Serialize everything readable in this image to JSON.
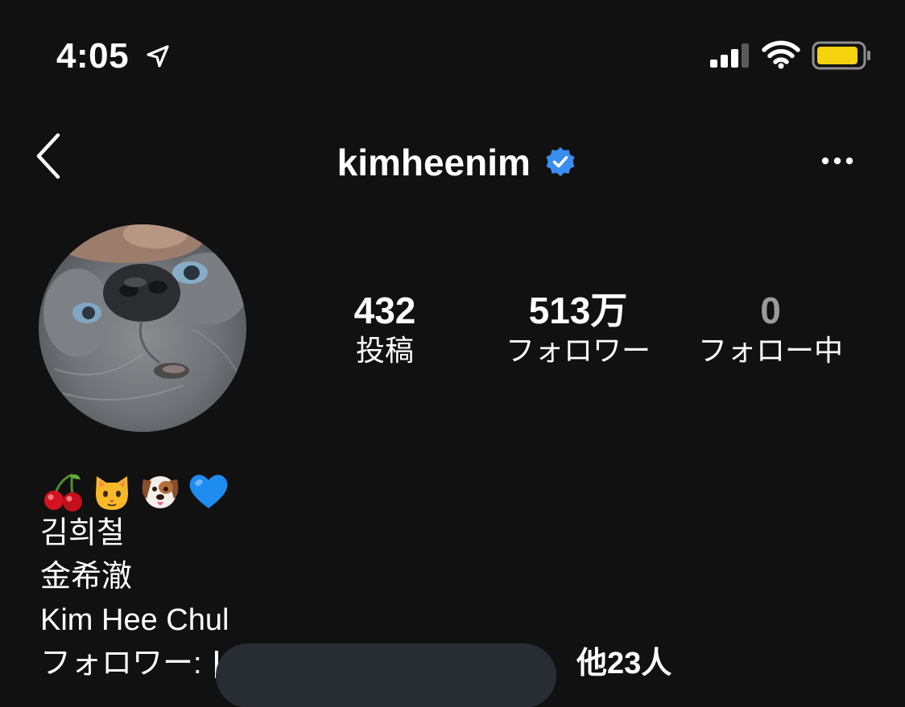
{
  "status_bar": {
    "time": "4:05",
    "battery_color": "#f5d30f"
  },
  "header": {
    "username": "kimheenim",
    "verified": true,
    "verified_color": "#3b8ef0"
  },
  "stats": {
    "posts": {
      "value": "432",
      "label": "投稿"
    },
    "followers": {
      "value": "513万",
      "label": "フォロワー"
    },
    "following": {
      "value": "0",
      "label": "フォロー中"
    }
  },
  "bio": {
    "emojis": [
      "cherries",
      "cat-face",
      "dog-face",
      "blue-heart"
    ],
    "lines": [
      "김희철",
      "金希澈",
      "Kim Hee Chul"
    ]
  },
  "followed_by": {
    "prefix": "フォロワー: ",
    "others": "他23人"
  },
  "colors": {
    "background": "#111112",
    "text": "#ffffff",
    "muted": "#9a9a9a",
    "redaction": "#282d33"
  }
}
